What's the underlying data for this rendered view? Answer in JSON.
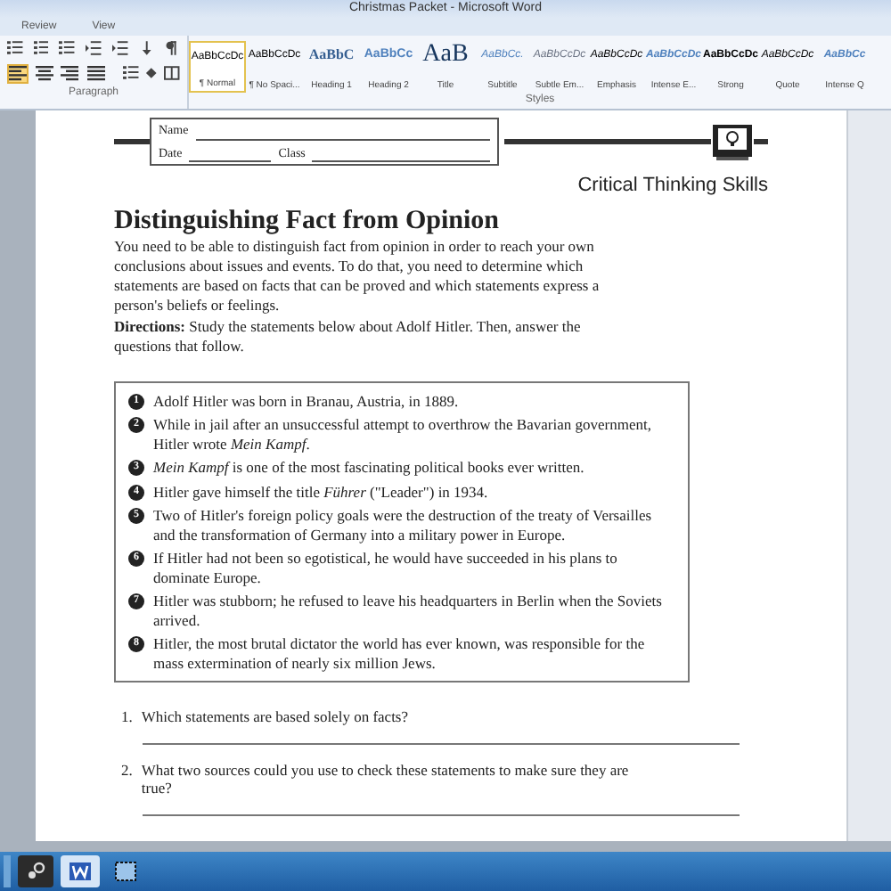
{
  "window": {
    "title": "Christmas Packet - Microsoft Word"
  },
  "menu_tabs": [
    {
      "label": "Review",
      "selected": false
    },
    {
      "label": "View",
      "selected": false
    }
  ],
  "ribbon": {
    "paragraph_group": {
      "label": "Paragraph",
      "align_buttons": [
        {
          "selected": true
        },
        {
          "selected": false
        },
        {
          "selected": false
        },
        {
          "selected": false
        }
      ]
    },
    "styles_group": {
      "label": "Styles",
      "styles": [
        {
          "preview": "AaBbCcDc",
          "label": "¶ Normal",
          "selected": true,
          "kind": "normal"
        },
        {
          "preview": "AaBbCcDc",
          "label": "¶ No Spaci...",
          "selected": false,
          "kind": "normal"
        },
        {
          "preview": "AaBbC",
          "label": "Heading 1",
          "selected": false,
          "kind": "heading1"
        },
        {
          "preview": "AaBbCc",
          "label": "Heading 2",
          "selected": false,
          "kind": "heading2"
        },
        {
          "preview": "AaB",
          "label": "Title",
          "selected": false,
          "kind": "title"
        },
        {
          "preview": "AaBbCc.",
          "label": "Subtitle",
          "selected": false,
          "kind": "subtitle"
        },
        {
          "preview": "AaBbCcDc",
          "label": "Subtle Em...",
          "selected": false,
          "kind": "subtle"
        },
        {
          "preview": "AaBbCcDc",
          "label": "Emphasis",
          "selected": false,
          "kind": "emphasis"
        },
        {
          "preview": "AaBbCcDc",
          "label": "Intense E...",
          "selected": false,
          "kind": "intense"
        },
        {
          "preview": "AaBbCcDc",
          "label": "Strong",
          "selected": false,
          "kind": "strong"
        },
        {
          "preview": "AaBbCcDc",
          "label": "Quote",
          "selected": false,
          "kind": "quote"
        },
        {
          "preview": "AaBbCc",
          "label": "Intense Q",
          "selected": false,
          "kind": "intense"
        }
      ]
    }
  },
  "document": {
    "name_label": "Name",
    "date_label": "Date",
    "class_label": "Class",
    "section": "Critical Thinking Skills",
    "heading": "Distinguishing Fact from Opinion",
    "intro": "You need to be able to distinguish fact from opinion in order to reach your own conclusions about issues and events. To do that, you need to determine which statements are based on facts that can be proved and which statements express a person's beliefs or feelings.",
    "directions_label": "Directions:",
    "directions": "Study the statements below about Adolf Hitler. Then, answer the questions that follow.",
    "statements": [
      {
        "number": "1",
        "text": "Adolf Hitler was born in Branau, Austria, in 1889."
      },
      {
        "number": "2",
        "text": "While in jail after an unsuccessful attempt to overthrow the Bavarian government, Hitler wrote *Mein Kampf*."
      },
      {
        "number": "3",
        "text": "*Mein Kampf* is one of the most fascinating political books ever written."
      },
      {
        "number": "4",
        "text": "Hitler gave himself the title *Führer* (\"Leader\") in 1934."
      },
      {
        "number": "5",
        "text": "Two of Hitler's foreign policy goals were the destruction of the treaty of Versailles and the transformation of Germany into a military power in Europe."
      },
      {
        "number": "6",
        "text": "If Hitler had not been so egotistical, he would have succeeded in his plans to dominate Europe."
      },
      {
        "number": "7",
        "text": "Hitler was stubborn; he refused to leave his headquarters in Berlin when the Soviets arrived."
      },
      {
        "number": "8",
        "text": "Hitler, the most brutal dictator the world has ever known, was responsible for the mass extermination of nearly six million Jews."
      }
    ],
    "questions": [
      {
        "number": "1.",
        "text": "Which statements are based solely on facts?"
      },
      {
        "number": "2.",
        "text": "What two sources could you use to check these statements to make sure they are true?"
      }
    ]
  }
}
